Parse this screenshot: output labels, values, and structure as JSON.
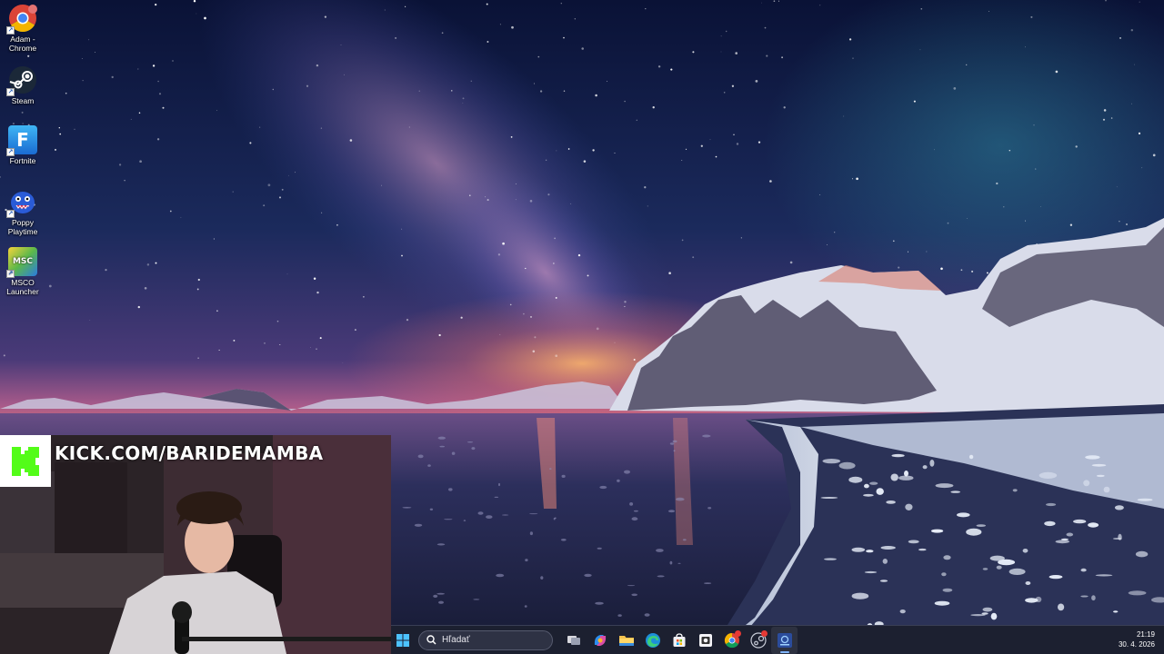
{
  "desktop": {
    "icons": [
      {
        "label": "Adam -\nChrome",
        "icon": "chrome-icon"
      },
      {
        "label": "Steam",
        "icon": "steam-icon"
      },
      {
        "label": "Fortnite",
        "icon": "fortnite-icon",
        "glyph": "F"
      },
      {
        "label": "Poppy\nPlaytime",
        "icon": "poppy-playtime-icon"
      },
      {
        "label": "MSCO\nLauncher",
        "icon": "msco-launcher-icon",
        "glyph": "MSC"
      }
    ]
  },
  "webcam": {
    "brand_letter": "K",
    "handle": "KICK.COM/BARIDEMAMBA",
    "brand_color": "#53fc18"
  },
  "taskbar": {
    "search_placeholder": "Hľadať",
    "apps": [
      "task-view-icon",
      "copilot-icon",
      "file-explorer-icon",
      "edge-icon",
      "microsoft-store-icon",
      "outlook-icon",
      "chrome-icon",
      "steam-icon",
      "active-app-icon"
    ],
    "clock": {
      "time": "21:19",
      "date": "30. 4. 2026"
    }
  },
  "colors": {
    "taskbar_bg": "#1c2030",
    "accent": "#7fb4ff"
  }
}
